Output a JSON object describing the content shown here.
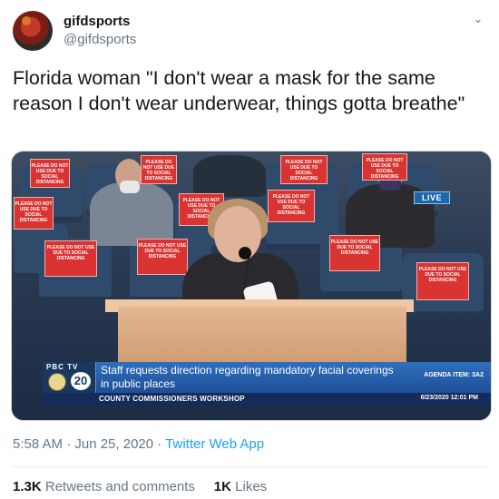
{
  "user": {
    "display_name": "gifdsports",
    "handle": "@gifdsports",
    "avatar_icon": "basketball-player-avatar"
  },
  "tweet": {
    "text": "Florida woman \"I don't wear a mask for the same reason I don't wear underwear, things gotta breathe\""
  },
  "media": {
    "signs": [
      "PLEASE DO NOT USE DUE TO SOCIAL DISTANCING",
      "PLEASE DO NOT USE DUE TO SOCIAL DISTANCING",
      "PLEASE DO NOT USE DUE TO SOCIAL DISTANCING",
      "PLEASE DO NOT USE DUE TO SOCIAL DISTANCING",
      "PLEASE DO NOT USE DUE TO SOCIAL DISTANCING",
      "PLEASE DO NOT USE DUE TO SOCIAL DISTANCING",
      "PLEASE DO NOT USE DUE TO SOCIAL DISTANCING",
      "PLEASE DO NOT USE DUE TO SOCIAL DISTANCING",
      "PLEASE DO NOT USE DUE TO SOCIAL DISTANCING",
      "PLEASE DO NOT USE DUE TO SOCIAL DISTANCING",
      "PLEASE DO NOT USE DUE TO SOCIAL DISTANCING"
    ],
    "live_label": "LIVE",
    "channel_logo_text": "PBC TV",
    "channel_number": "20",
    "caption": "Staff requests direction regarding mandatory facial coverings in public places",
    "agenda_item": "AGENDA ITEM: 3A2",
    "workshop": "COUNTY COMMISSIONERS WORKSHOP",
    "datetime": "6/23/2020 12:01 PM"
  },
  "meta": {
    "time_date": "5:58 AM · Jun 25, 2020 · ",
    "app": "Twitter Web App"
  },
  "stats": {
    "retweets_count": "1.3K",
    "retweets_label": "Retweets and comments",
    "likes_count": "1K",
    "likes_label": "Likes"
  },
  "colors": {
    "accent": "#1da1f2",
    "text_secondary": "#657786",
    "sign_red": "#d93431",
    "lower_third_blue": "#1f4f98"
  }
}
